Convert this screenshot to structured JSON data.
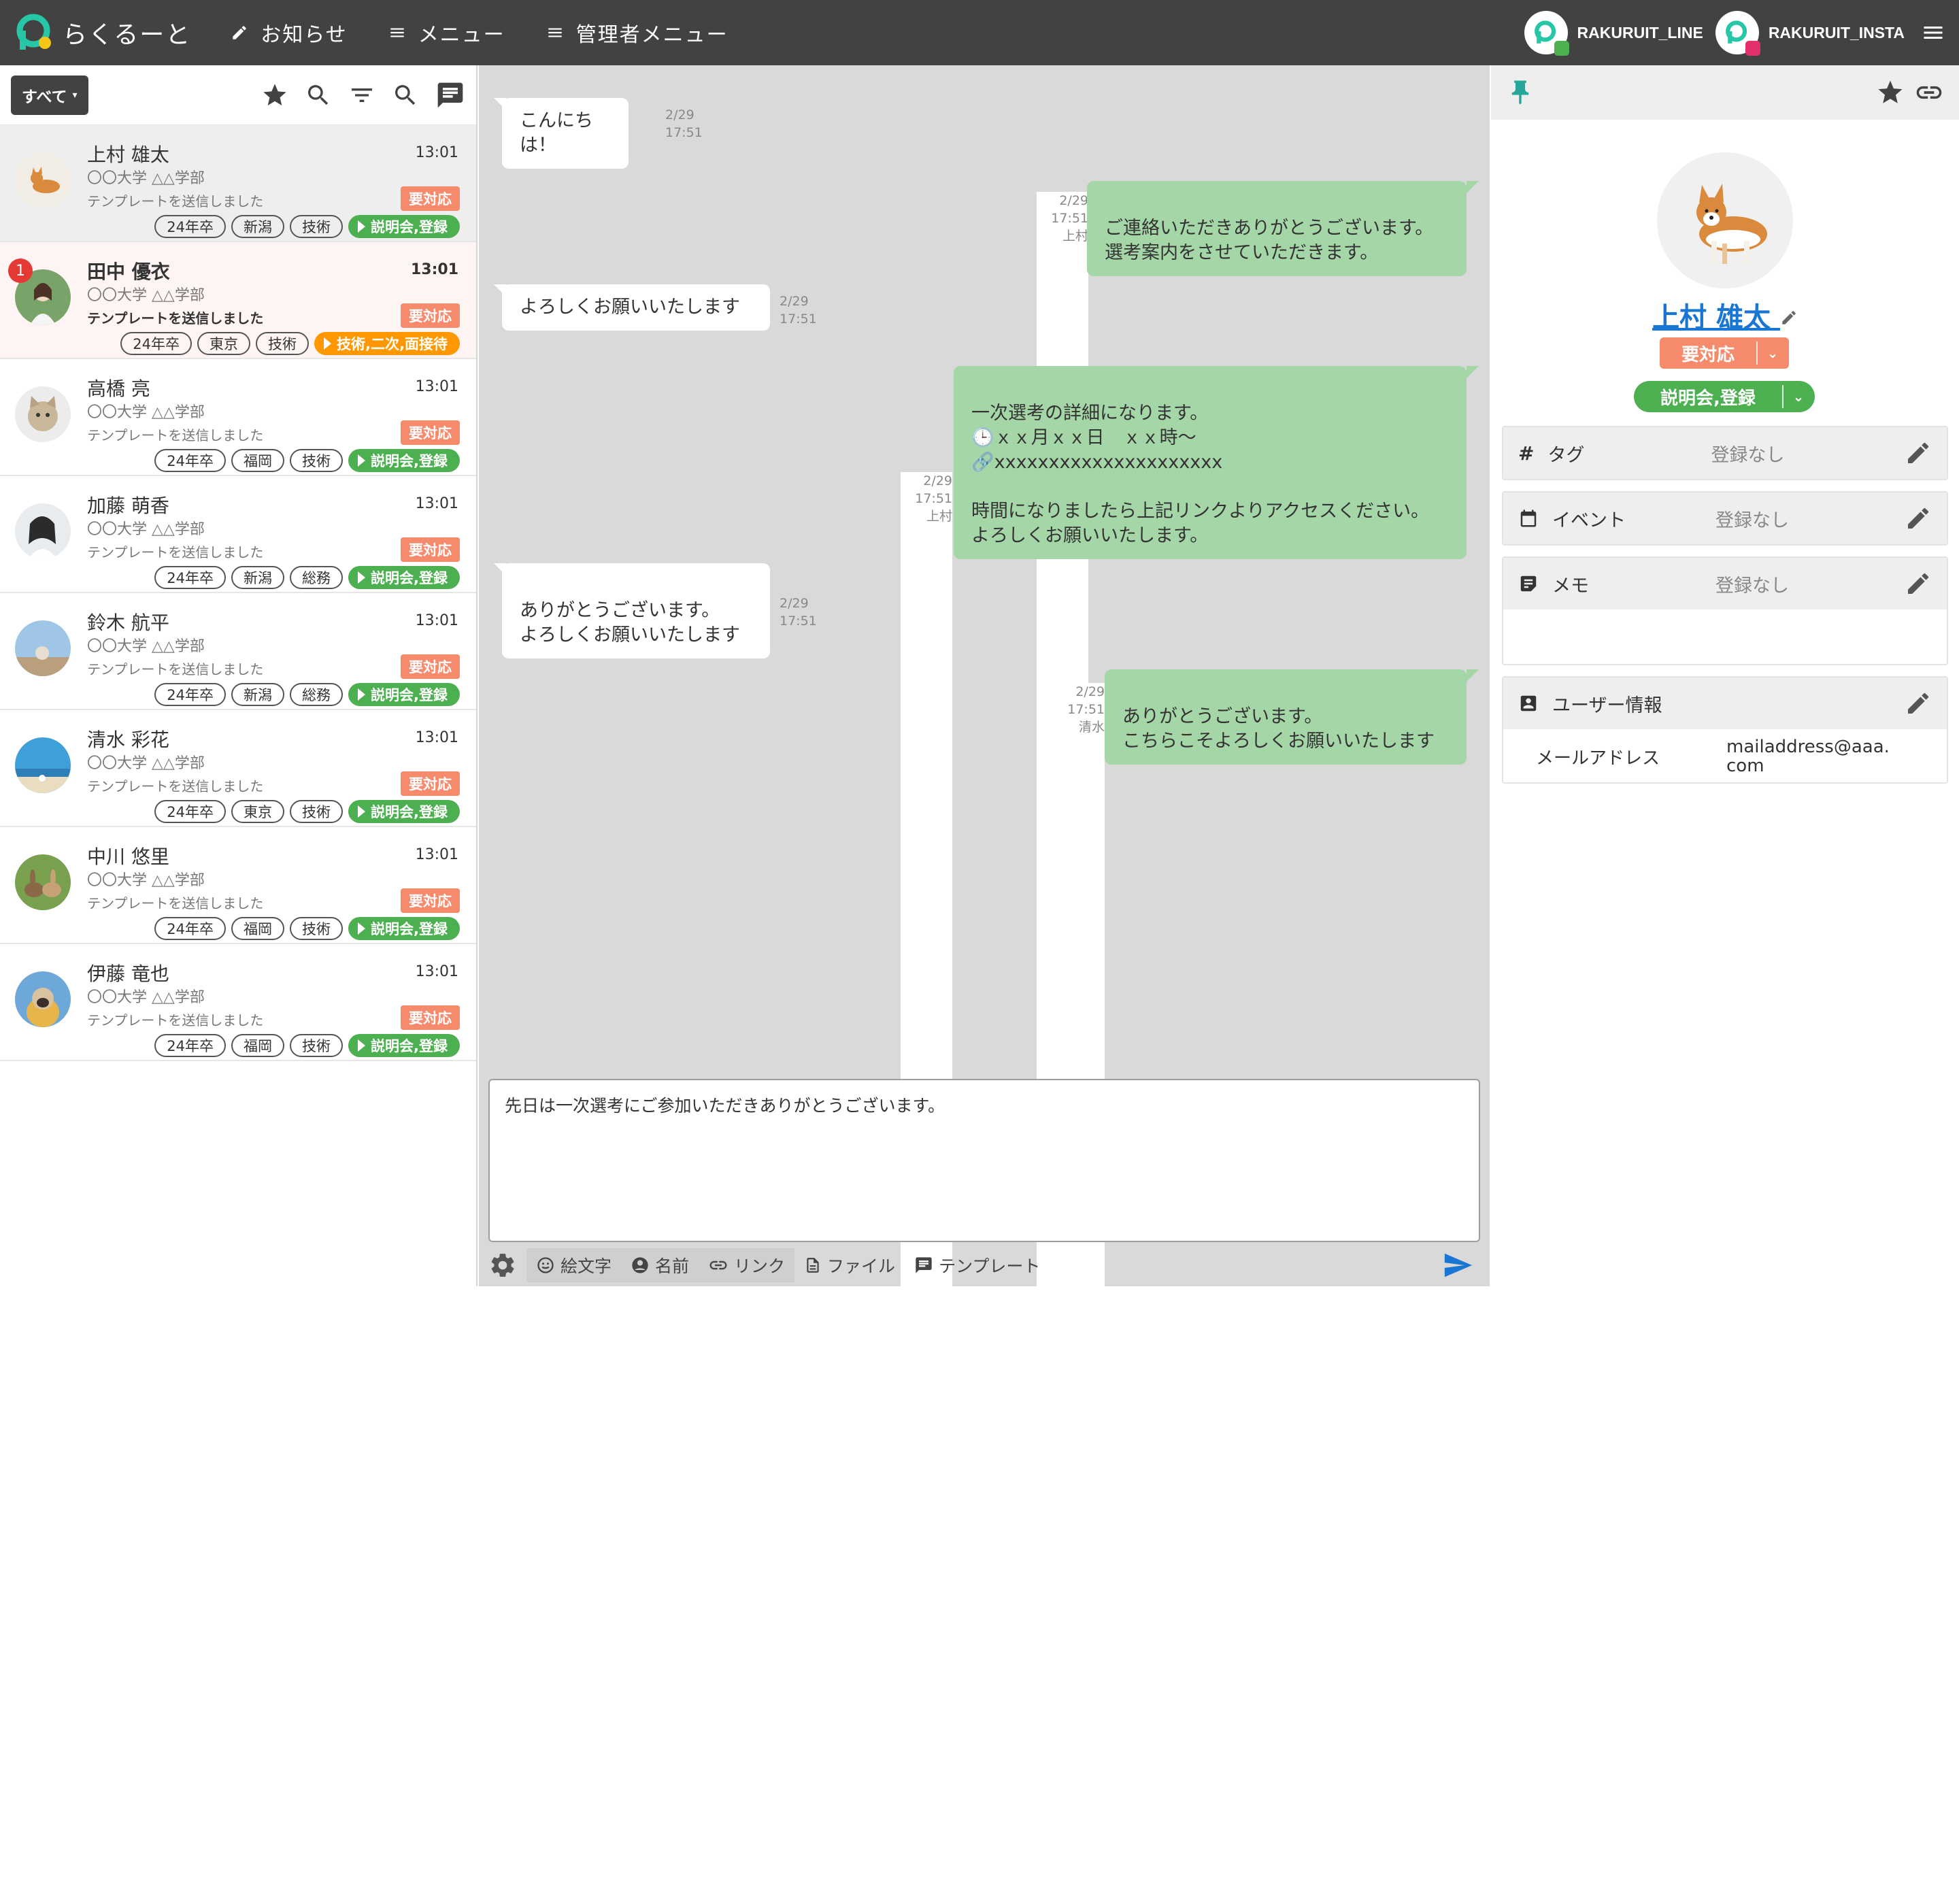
{
  "app": {
    "name": "らくるーと"
  },
  "nav": {
    "news": "お知らせ",
    "menu": "メニュー",
    "admin_menu": "管理者メニュー"
  },
  "accounts": [
    {
      "name": "RAKURUIT_LINE",
      "badge_color": "#4caf50"
    },
    {
      "name": "RAKURUIT_INSTA",
      "badge_color": "#e1306c"
    }
  ],
  "colors": {
    "topbar": "#424242",
    "status": "#f58b6c",
    "stage_green": "#4caf50",
    "stage_orange": "#ff9800",
    "bubble_out": "#a5d6a7",
    "brand": "#26c6a6"
  },
  "list": {
    "filter_label": "すべて",
    "items": [
      {
        "name": "上村 雄太",
        "time": "13:01",
        "school": "〇〇大学 △△学部",
        "last": "テンプレートを送信しました",
        "status": "要対応",
        "tags": [
          "24年卒",
          "新潟",
          "技術"
        ],
        "stage": "説明会,登録",
        "avatar": "dog"
      },
      {
        "name": "田中 優衣",
        "time": "13:01",
        "school": "〇〇大学 △△学部",
        "last": "テンプレートを送信しました",
        "status": "要対応",
        "tags": [
          "24年卒",
          "東京",
          "技術"
        ],
        "stage": "技術,二次,面接待",
        "unread": "1",
        "avatar": "woman"
      },
      {
        "name": "高橋 亮",
        "time": "13:01",
        "school": "〇〇大学 △△学部",
        "last": "テンプレートを送信しました",
        "status": "要対応",
        "tags": [
          "24年卒",
          "福岡",
          "技術"
        ],
        "stage": "説明会,登録",
        "avatar": "cat"
      },
      {
        "name": "加藤 萌香",
        "time": "13:01",
        "school": "〇〇大学 △△学部",
        "last": "テンプレートを送信しました",
        "status": "要対応",
        "tags": [
          "24年卒",
          "新潟",
          "総務"
        ],
        "stage": "説明会,登録",
        "avatar": "girl"
      },
      {
        "name": "鈴木 航平",
        "time": "13:01",
        "school": "〇〇大学 △△学部",
        "last": "テンプレートを送信しました",
        "status": "要対応",
        "tags": [
          "24年卒",
          "新潟",
          "総務"
        ],
        "stage": "説明会,登録",
        "avatar": "sky"
      },
      {
        "name": "清水 彩花",
        "time": "13:01",
        "school": "〇〇大学 △△学部",
        "last": "テンプレートを送信しました",
        "status": "要対応",
        "tags": [
          "24年卒",
          "東京",
          "技術"
        ],
        "stage": "説明会,登録",
        "avatar": "beach"
      },
      {
        "name": "中川 悠里",
        "time": "13:01",
        "school": "〇〇大学 △△学部",
        "last": "テンプレートを送信しました",
        "status": "要対応",
        "tags": [
          "24年卒",
          "福岡",
          "技術"
        ],
        "stage": "説明会,登録",
        "avatar": "rabbit"
      },
      {
        "name": "伊藤 竜也",
        "time": "13:01",
        "school": "〇〇大学 △△学部",
        "last": "テンプレートを送信しました",
        "status": "要対応",
        "tags": [
          "24年卒",
          "福岡",
          "技術"
        ],
        "stage": "説明会,登録",
        "avatar": "pug"
      }
    ]
  },
  "chat": {
    "messages": [
      {
        "dir": "in",
        "text": "こんにちは！",
        "date": "2/29",
        "time": "17:51"
      },
      {
        "dir": "out",
        "text": "ご連絡いただきありがとうございます。\n選考案内をさせていただきます。",
        "date": "2/29",
        "time": "17:51",
        "sender": "上村"
      },
      {
        "dir": "in",
        "text": "よろしくお願いいたします",
        "date": "2/29",
        "time": "17:51"
      },
      {
        "dir": "out",
        "text": "一次選考の詳細になります。\n🕒ｘｘ月ｘｘ日　ｘｘ時～\n🔗xxxxxxxxxxxxxxxxxxxxx\n\n時間になりましたら上記リンクよりアクセスください。\nよろしくお願いいたします。",
        "date": "2/29",
        "time": "17:51",
        "sender": "上村"
      },
      {
        "dir": "in",
        "text": "ありがとうございます。\nよろしくお願いいたします",
        "date": "2/29",
        "time": "17:51"
      },
      {
        "dir": "out",
        "text": "ありがとうございます。\nこちらこそよろしくお願いいたします",
        "date": "2/29",
        "time": "17:51",
        "sender": "清水"
      }
    ],
    "composer_value": "先日は一次選考にご参加いただきありがとうございます。",
    "tools": {
      "emoji": "絵文字",
      "name": "名前",
      "link": "リンク",
      "file": "ファイル",
      "template": "テンプレート"
    }
  },
  "profile": {
    "name": "上村 雄太",
    "status": "要対応",
    "stage": "説明会,登録",
    "tag_label": "タグ",
    "event_label": "イベント",
    "memo_label": "メモ",
    "none": "登録なし",
    "userinfo_label": "ユーザー情報",
    "email_label": "メールアドレス",
    "email_line1": "mailaddress@aaa.",
    "email_line2": "com"
  }
}
